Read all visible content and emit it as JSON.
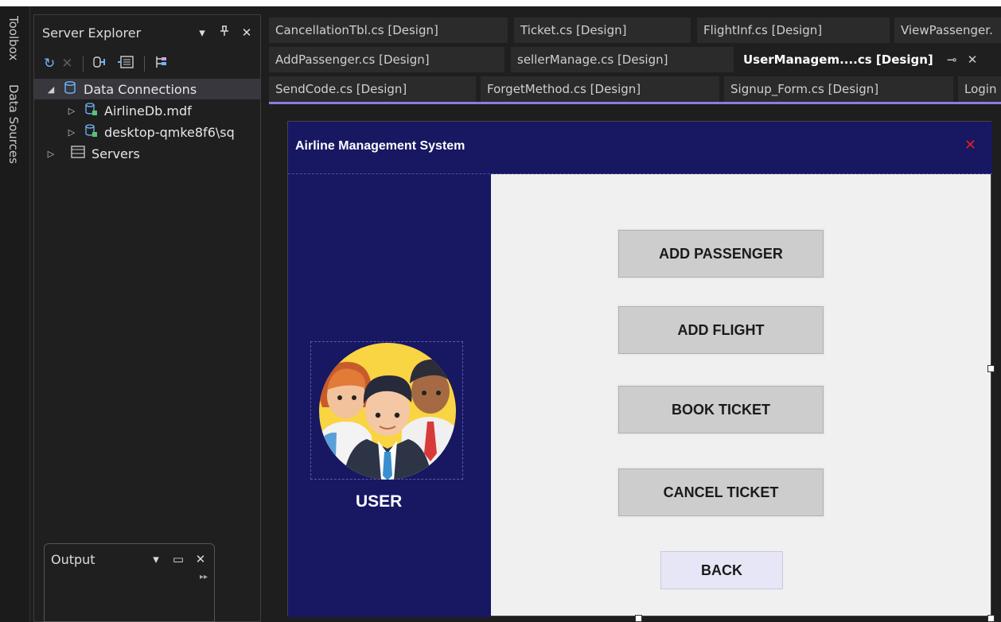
{
  "sidebar_tabs": [
    "Toolbox",
    "Data Sources"
  ],
  "server_explorer": {
    "title": "Server Explorer",
    "tree": [
      {
        "label": "Data Connections",
        "icon": "database-icon"
      },
      {
        "label": "AirlineDb.mdf",
        "icon": "db-file-icon"
      },
      {
        "label": "desktop-qmke8f6\\sq",
        "icon": "db-file-icon"
      },
      {
        "label": "Servers",
        "icon": "server-icon"
      }
    ]
  },
  "output": {
    "title": "Output"
  },
  "tabs": {
    "row1": [
      "CancellationTbl.cs [Design]",
      "Ticket.cs [Design]",
      "FlightInf.cs [Design]",
      "ViewPassenger."
    ],
    "row2": [
      "AddPassenger.cs [Design]",
      "sellerManage.cs [Design]",
      "UserManagem....cs [Design]"
    ],
    "row3": [
      "SendCode.cs [Design]",
      "ForgetMethod.cs [Design]",
      "Signup_Form.cs [Design]",
      "Login"
    ]
  },
  "form": {
    "title": "Airline Management System",
    "close_glyph": "✕",
    "user_label": "USER",
    "buttons": [
      "ADD PASSENGER",
      "ADD FLIGHT",
      "BOOK TICKET",
      "CANCEL TICKET"
    ],
    "back_label": "BACK"
  },
  "colors": {
    "form_header": "#171762",
    "close": "#e02020",
    "button_bg": "#cdcdcd",
    "back_bg": "#e6e6f7",
    "tab_accent": "#8a7de0"
  }
}
